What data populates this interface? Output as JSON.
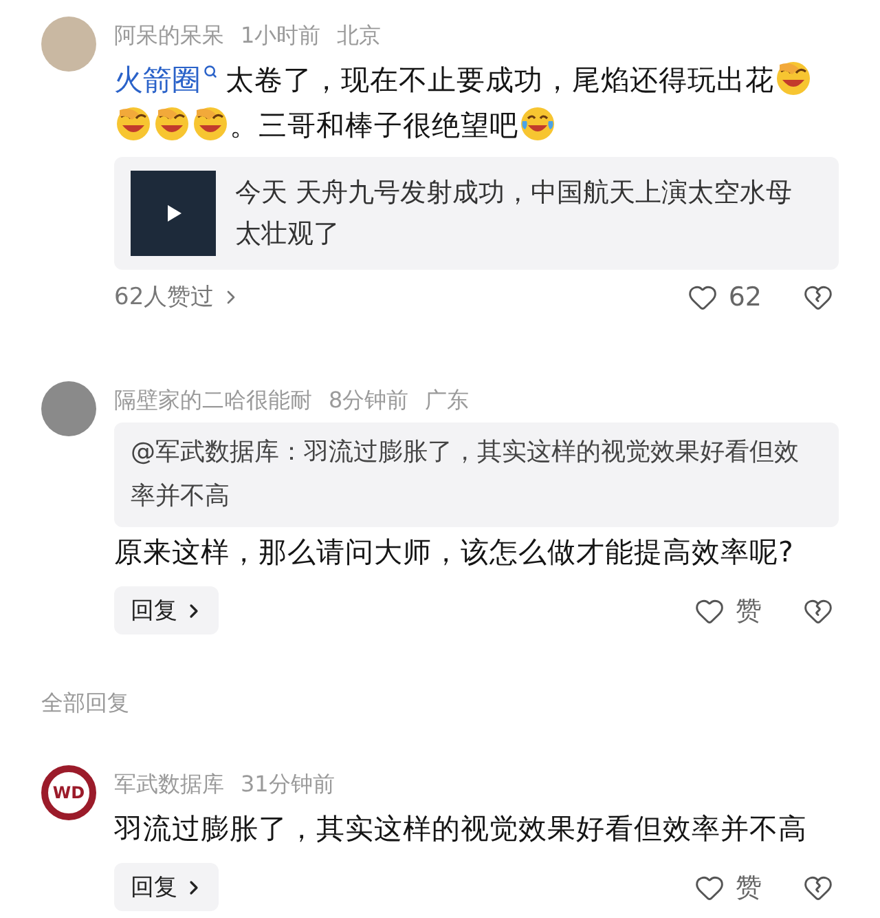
{
  "items": [
    {
      "kind": "comment",
      "avatar": {
        "kind": "photo"
      },
      "author": "阿呆的呆呆",
      "time": "1小时前",
      "location": "北京",
      "body": [
        {
          "kind": "topic",
          "text": "火箭圈"
        },
        {
          "kind": "text",
          "text": "太卷了，现在不止要成功，尾焰还得玩出花"
        },
        {
          "kind": "laugh-cover"
        },
        {
          "kind": "laugh-cover"
        },
        {
          "kind": "laugh-cover"
        },
        {
          "kind": "laugh-cover"
        },
        {
          "kind": "text",
          "text": "。三哥和棒子很绝望吧"
        },
        {
          "kind": "laugh-tears"
        }
      ],
      "card": {
        "kind": "video",
        "text": "今天 天舟九号发射成功，中国航天上演太空水母太壮观了"
      },
      "footer": {
        "kind": "summary",
        "summary": "62人赞过",
        "like_label": "62",
        "liked": false
      }
    },
    {
      "kind": "comment",
      "avatar": {
        "kind": "photo"
      },
      "author": "隔壁家的二哈很能耐",
      "time": "8分钟前",
      "location": "广东",
      "quote": "@军武数据库：羽流过膨胀了，其实这样的视觉效果好看但效率并不高",
      "body": [
        {
          "kind": "text",
          "text": "原来这样，那么请问大师，该怎么做才能提高效率呢?"
        }
      ],
      "footer": {
        "kind": "reply",
        "reply_label": "回复",
        "like_label": "赞",
        "liked": false
      }
    },
    {
      "kind": "section",
      "label": "全部回复"
    },
    {
      "kind": "comment",
      "avatar": {
        "kind": "logo",
        "text": "WD"
      },
      "author": "军武数据库",
      "time": "31分钟前",
      "body": [
        {
          "kind": "text",
          "text": "羽流过膨胀了，其实这样的视觉效果好看但效率并不高"
        }
      ],
      "footer": {
        "kind": "reply",
        "reply_label": "回复",
        "like_label": "赞",
        "liked": false
      }
    }
  ]
}
